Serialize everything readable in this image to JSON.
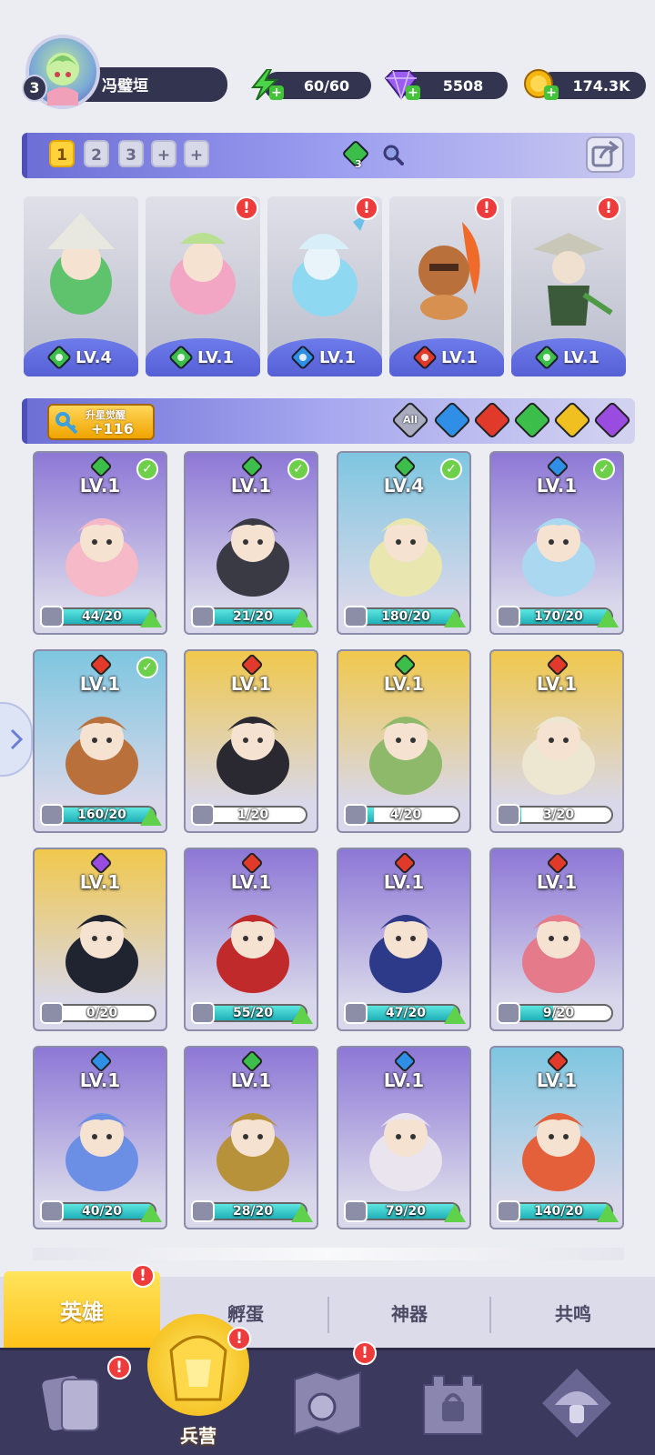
{
  "player": {
    "level": "3",
    "name": "冯璧垣"
  },
  "resources": [
    {
      "id": "energy",
      "value": "60/60",
      "color": "#4bd44a"
    },
    {
      "id": "gems",
      "value": "5508",
      "color": "#9b5cf0"
    },
    {
      "id": "gold",
      "value": "174.3K",
      "color": "#f5b70f"
    }
  ],
  "team": {
    "tabs": [
      "1",
      "2",
      "3",
      "+",
      "+"
    ],
    "active_tab": "1",
    "element_count": "3",
    "members": [
      {
        "level": "LV.4",
        "element": "wind",
        "color": "#5fc36d"
      },
      {
        "level": "LV.1",
        "element": "wind",
        "color": "#f2a6c4"
      },
      {
        "level": "LV.1",
        "element": "water",
        "color": "#8fd8f2"
      },
      {
        "level": "LV.1",
        "element": "fire",
        "color": "#e27b2e"
      },
      {
        "level": "LV.1",
        "element": "wind",
        "color": "#4f9a45"
      }
    ]
  },
  "awaken": {
    "label": "升星觉醒",
    "count": "+116"
  },
  "filters": [
    {
      "label": "All",
      "color": "#a9abbf"
    },
    {
      "label": "water",
      "color": "#2f8fe6"
    },
    {
      "label": "fire",
      "color": "#e23a2a"
    },
    {
      "label": "wind",
      "color": "#3cbf4a"
    },
    {
      "label": "light",
      "color": "#f0c020"
    },
    {
      "label": "dark",
      "color": "#9a4be0"
    }
  ],
  "heroes": [
    {
      "level": "LV.1",
      "progress": "44/20",
      "fill": 1.0,
      "el": "#3cbf4a",
      "bg": "#8d77d6",
      "art": "#f5b9c8",
      "check": true,
      "up": true
    },
    {
      "level": "LV.1",
      "progress": "21/20",
      "fill": 1.0,
      "el": "#3cbf4a",
      "bg": "#8d77d6",
      "art": "#3a3a44",
      "check": true,
      "up": true
    },
    {
      "level": "LV.4",
      "progress": "180/20",
      "fill": 1.0,
      "el": "#3cbf4a",
      "bg": "#7ec6e0",
      "art": "#e9e6b0",
      "check": true,
      "up": true
    },
    {
      "level": "LV.1",
      "progress": "170/20",
      "fill": 1.0,
      "el": "#2f8fe6",
      "bg": "#8d77d6",
      "art": "#a9d8f0",
      "check": true,
      "up": true
    },
    {
      "level": "LV.1",
      "progress": "160/20",
      "fill": 1.0,
      "el": "#e23a2a",
      "bg": "#7ec6e0",
      "art": "#b9703a",
      "check": true,
      "up": true
    },
    {
      "level": "LV.1",
      "progress": "1/20",
      "fill": 0.05,
      "el": "#e23a2a",
      "bg": "#f0c84c",
      "art": "#2a2830",
      "check": false,
      "up": false
    },
    {
      "level": "LV.1",
      "progress": "4/20",
      "fill": 0.2,
      "el": "#3cbf4a",
      "bg": "#f0c84c",
      "art": "#8fb96a",
      "check": false,
      "up": false
    },
    {
      "level": "LV.1",
      "progress": "3/20",
      "fill": 0.15,
      "el": "#e23a2a",
      "bg": "#f0c84c",
      "art": "#ede6d0",
      "check": false,
      "up": false
    },
    {
      "level": "LV.1",
      "progress": "0/20",
      "fill": 0.0,
      "el": "#9a4be0",
      "bg": "#f0c84c",
      "art": "#1f2430",
      "check": false,
      "up": false
    },
    {
      "level": "LV.1",
      "progress": "55/20",
      "fill": 1.0,
      "el": "#e23a2a",
      "bg": "#8d77d6",
      "art": "#c02a2a",
      "check": false,
      "up": true
    },
    {
      "level": "LV.1",
      "progress": "47/20",
      "fill": 1.0,
      "el": "#e23a2a",
      "bg": "#8d77d6",
      "art": "#2d3a8a",
      "check": false,
      "up": true
    },
    {
      "level": "LV.1",
      "progress": "9/20",
      "fill": 0.45,
      "el": "#e23a2a",
      "bg": "#8d77d6",
      "art": "#e47a8a",
      "check": false,
      "up": false
    },
    {
      "level": "LV.1",
      "progress": "40/20",
      "fill": 1.0,
      "el": "#2f8fe6",
      "bg": "#8d77d6",
      "art": "#6c8fe6",
      "check": false,
      "up": true
    },
    {
      "level": "LV.1",
      "progress": "28/20",
      "fill": 1.0,
      "el": "#3cbf4a",
      "bg": "#8d77d6",
      "art": "#b8923a",
      "check": false,
      "up": true
    },
    {
      "level": "LV.1",
      "progress": "79/20",
      "fill": 1.0,
      "el": "#2f8fe6",
      "bg": "#8d77d6",
      "art": "#e9e4ee",
      "check": false,
      "up": true
    },
    {
      "level": "LV.1",
      "progress": "140/20",
      "fill": 1.0,
      "el": "#e23a2a",
      "bg": "#7ec6e0",
      "art": "#e4603a",
      "check": false,
      "up": true
    }
  ],
  "tabs": [
    {
      "label": "英雄",
      "active": true,
      "alert": "!"
    },
    {
      "label": "孵蛋",
      "active": false
    },
    {
      "label": "神器",
      "active": false
    },
    {
      "label": "共鸣",
      "active": false
    }
  ],
  "nav": [
    {
      "icon": "cards-icon",
      "alert": "!"
    },
    {
      "icon": "barracks-icon",
      "label": "兵营",
      "alert": "!"
    },
    {
      "icon": "map-icon",
      "alert": "!"
    },
    {
      "icon": "locked-castle-icon"
    },
    {
      "icon": "mushroom-icon"
    }
  ]
}
